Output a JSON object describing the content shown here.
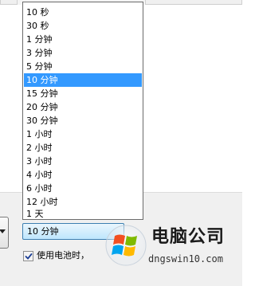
{
  "dropdown": {
    "options": [
      "10 秒",
      "30 秒",
      "1 分钟",
      "3 分钟",
      "5 分钟",
      "10 分钟",
      "15 分钟",
      "20 分钟",
      "30 分钟",
      "1 小时",
      "2 小时",
      "3 小时",
      "4 小时",
      "6 小时",
      "12 小时",
      "1 天"
    ],
    "selected_index": 5
  },
  "combo": {
    "value": "10 分钟"
  },
  "battery_checkbox": {
    "label": "使用电池时，",
    "checked": true
  },
  "watermark": {
    "title": "电脑公司",
    "url": "dngswin10.com"
  },
  "colors": {
    "selection": "#3399ff",
    "combo_border": "#3c7fb1",
    "logo_red": "#f25022",
    "logo_green": "#7fba00",
    "logo_blue": "#00a4ef",
    "logo_yellow": "#ffb900"
  }
}
